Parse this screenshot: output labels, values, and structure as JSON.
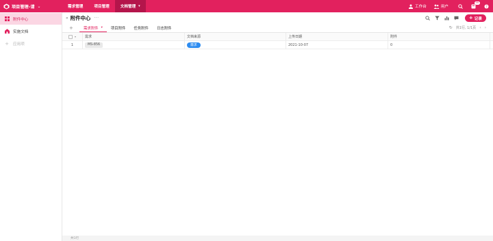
{
  "app": {
    "name": "项目管理-请",
    "brand_color": "#e2215e"
  },
  "topnav": [
    {
      "label": "需求管理",
      "active": false
    },
    {
      "label": "项目管理",
      "active": false
    },
    {
      "label": "文档管理",
      "active": true
    }
  ],
  "topright": {
    "workbench_label": "工作台",
    "users_label": "用户",
    "badge": "99"
  },
  "sidebar": {
    "items": [
      {
        "label": "附件中心",
        "active": true,
        "icon": "grid-icon"
      },
      {
        "label": "实施文档",
        "active": false,
        "icon": "house-icon"
      },
      {
        "label": "应用项",
        "active": false,
        "icon": "plus-icon"
      }
    ]
  },
  "page": {
    "title": "附件中心",
    "more": "···",
    "add_label": "记录",
    "page_info": "共1行, 1/1页"
  },
  "tabs": [
    {
      "label": "需求附件",
      "active": true
    },
    {
      "label": "项目附件",
      "active": false
    },
    {
      "label": "任务附件",
      "active": false
    },
    {
      "label": "日志附件",
      "active": false
    }
  ],
  "table": {
    "headers": [
      "需求",
      "文档来源",
      "上传日期",
      "附件"
    ],
    "rows": [
      {
        "index": "1",
        "demand": "MS-856",
        "source": "需求",
        "date": "2021-10-07",
        "attachment": "0"
      }
    ]
  },
  "footer": {
    "text": "共1行"
  }
}
